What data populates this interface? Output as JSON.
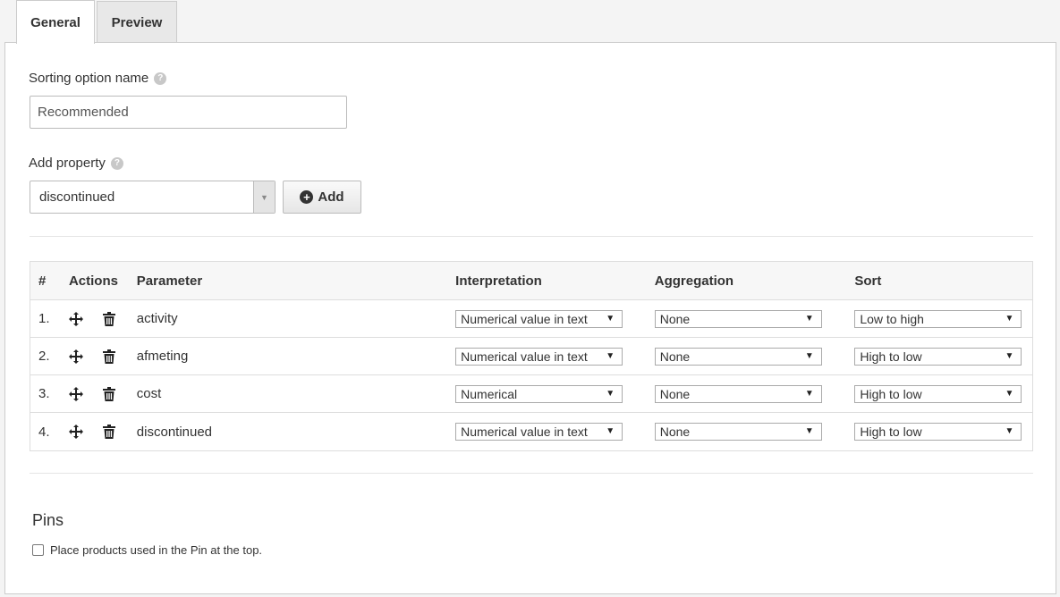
{
  "tabs": {
    "general": "General",
    "preview": "Preview"
  },
  "form": {
    "name_label": "Sorting option name",
    "name_value": "Recommended",
    "property_label": "Add property",
    "property_value": "discontinued",
    "add_label": "Add"
  },
  "table": {
    "headers": {
      "num": "#",
      "actions": "Actions",
      "parameter": "Parameter",
      "interpretation": "Interpretation",
      "aggregation": "Aggregation",
      "sort": "Sort"
    },
    "rows": [
      {
        "num": "1.",
        "parameter": "activity",
        "interpretation": "Numerical value in text",
        "aggregation": "None",
        "sort": "Low to high"
      },
      {
        "num": "2.",
        "parameter": "afmeting",
        "interpretation": "Numerical value in text",
        "aggregation": "None",
        "sort": "High to low"
      },
      {
        "num": "3.",
        "parameter": "cost",
        "interpretation": "Numerical",
        "aggregation": "None",
        "sort": "High to low"
      },
      {
        "num": "4.",
        "parameter": "discontinued",
        "interpretation": "Numerical value in text",
        "aggregation": "None",
        "sort": "High to low"
      }
    ]
  },
  "pins": {
    "title": "Pins",
    "checkbox_label": "Place products used in the Pin at the top."
  },
  "icons": {
    "help": "help-icon",
    "move": "move-icon",
    "trash": "trash-icon",
    "plus": "plus-circle-icon",
    "dropdown": "chevron-down-icon"
  }
}
